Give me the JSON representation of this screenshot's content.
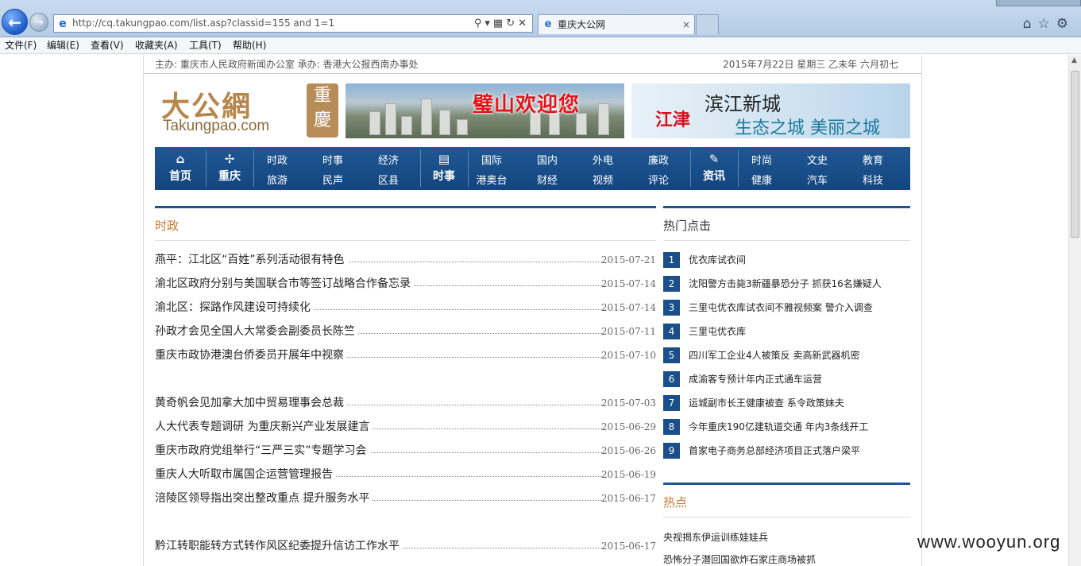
{
  "browser": {
    "url": "http://cq.takungpao.com/list.asp?classid=155 and 1=1",
    "tab_title": "重庆大公网",
    "tab_close": "×",
    "menu": [
      "文件(F)",
      "编辑(E)",
      "查看(V)",
      "收藏夹(A)",
      "工具(T)",
      "帮助(H)"
    ],
    "icons": [
      "back-arrow-icon",
      "forward-arrow-icon",
      "ie-logo-icon",
      "search-icon",
      "refresh-icon",
      "stop-icon",
      "home-icon",
      "favorites-star-icon",
      "gear-icon"
    ]
  },
  "site": {
    "host_line": "主办: 重庆市人民政府新闻办公室 承办: 香港大公报西南办事处",
    "date_line": "2015年7月22日 星期三 乙未年 六月初七",
    "logo_cn": "大公網",
    "logo_en": "Takungpao.com",
    "logo_seal": "重慶",
    "banner1_text": "璧山欢迎您",
    "banner2_brand": "江津",
    "banner2_title": "滨江新城",
    "banner2_slogan": "生态之城 美丽之城"
  },
  "nav": {
    "home": "首页",
    "chongqing": "重庆",
    "group1": [
      "时政",
      "时事",
      "经济",
      "旅游",
      "民声",
      "区县"
    ],
    "shishi": "时事",
    "group2": [
      "国际",
      "国内",
      "外电",
      "廉政",
      "港奥台",
      "财经",
      "视频",
      "评论"
    ],
    "zixun": "资讯",
    "group3": [
      "时尚",
      "文史",
      "教育",
      "健康",
      "汽车",
      "科技"
    ]
  },
  "main": {
    "section_title": "时政",
    "articles": [
      {
        "title": "燕平：江北区“百姓”系列活动很有特色",
        "date": "2015-07-21"
      },
      {
        "title": "渝北区政府分别与美国联合市等签订战略合作备忘录",
        "date": "2015-07-14"
      },
      {
        "title": "渝北区：探路作风建设可持续化",
        "date": "2015-07-14"
      },
      {
        "title": "孙政才会见全国人大常委会副委员长陈竺",
        "date": "2015-07-11"
      },
      {
        "title": "重庆市政协港澳台侨委员开展年中视察",
        "date": "2015-07-10"
      },
      {
        "title": "黄奇帆会见加拿大加中贸易理事会总裁",
        "date": "2015-07-03"
      },
      {
        "title": "人大代表专题调研 为重庆新兴产业发展建言",
        "date": "2015-06-29"
      },
      {
        "title": "重庆市政府党组举行“三严三实”专题学习会",
        "date": "2015-06-26"
      },
      {
        "title": "重庆人大听取市属国企运营管理报告",
        "date": "2015-06-19"
      },
      {
        "title": "涪陵区领导指出突出整改重点 提升服务水平",
        "date": "2015-06-17"
      },
      {
        "title": "黔江转职能转方式转作风区纪委提升信访工作水平",
        "date": "2015-06-17"
      }
    ]
  },
  "sidebar": {
    "hot_title": "热门点击",
    "hot": [
      {
        "num": "1",
        "title": "优衣库试衣间"
      },
      {
        "num": "2",
        "title": "沈阳警方击毙3新疆暴恐分子 抓获16名嫌疑人"
      },
      {
        "num": "3",
        "title": "三里屯优衣库试衣间不雅视频案 警介入调查"
      },
      {
        "num": "4",
        "title": "三里屯优衣库"
      },
      {
        "num": "5",
        "title": "四川军工企业4人被策反 卖高新武器机密"
      },
      {
        "num": "6",
        "title": "成渝客专预计年内正式通车运营"
      },
      {
        "num": "7",
        "title": "运城副市长王健康被查 系令政策妹夫"
      },
      {
        "num": "8",
        "title": "今年重庆190亿建轨道交通 年内3条线开工"
      },
      {
        "num": "9",
        "title": "首家电子商务总部经济项目正式落户梁平"
      }
    ],
    "hotspot_title": "热点",
    "hotspot": [
      "央视揭东伊运训练娃娃兵",
      "恐怖分子潜回国欲炸石家庄商场被抓"
    ]
  },
  "watermark": "www.wooyun.org"
}
